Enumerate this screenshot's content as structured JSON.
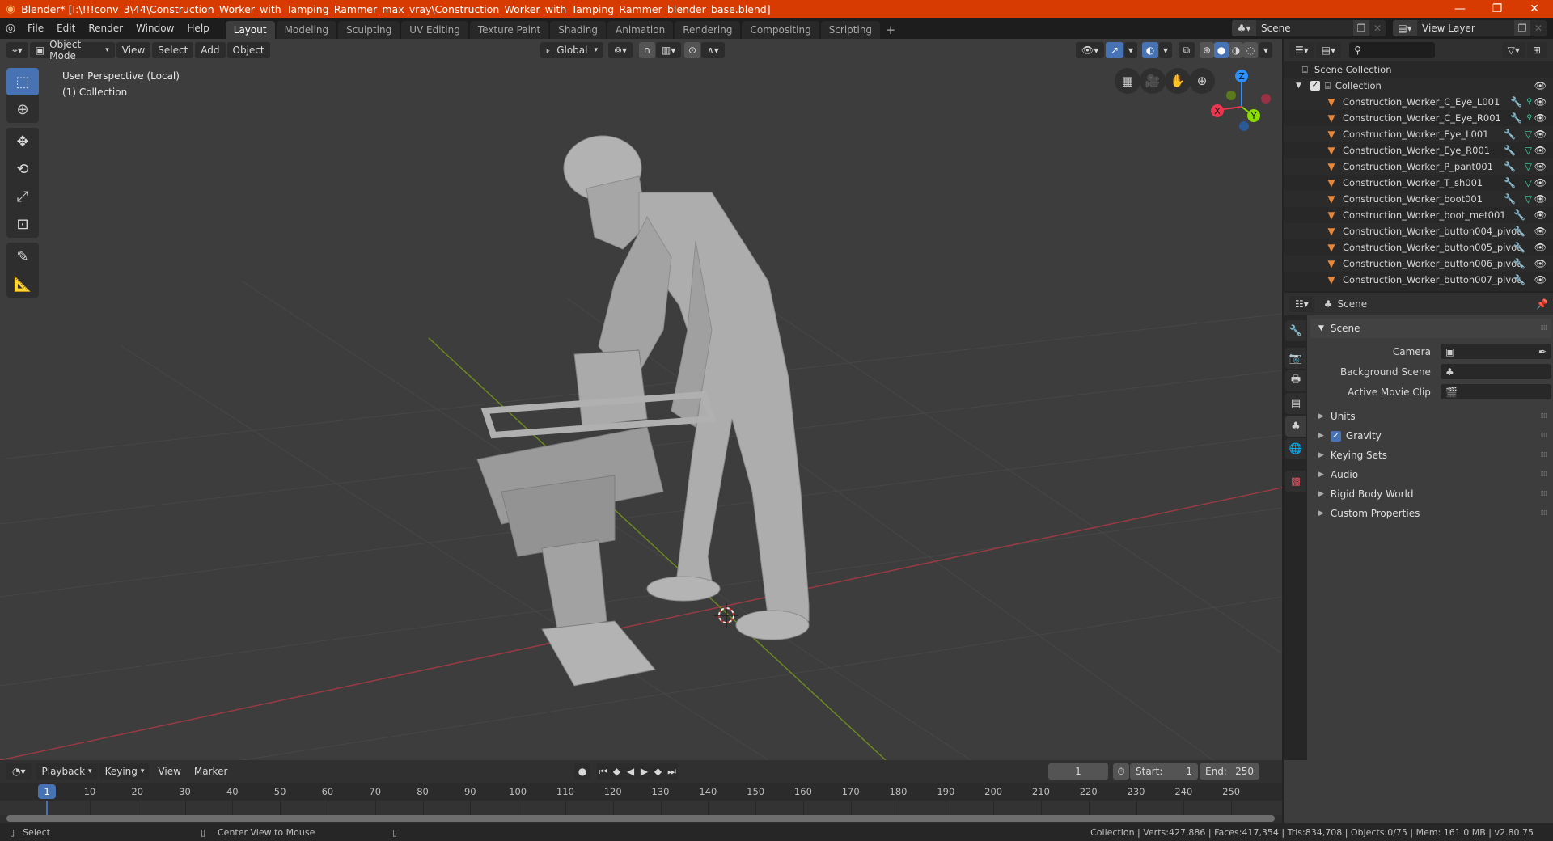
{
  "window": {
    "title": "Blender* [I:\\!!!conv_3\\44\\Construction_Worker_with_Tamping_Rammer_max_vray\\Construction_Worker_with_Tamping_Rammer_blender_base.blend]",
    "controls": {
      "minimize": "—",
      "maximize": "❐",
      "close": "✕"
    }
  },
  "menu": [
    "File",
    "Edit",
    "Render",
    "Window",
    "Help"
  ],
  "workspaces": {
    "tabs": [
      "Layout",
      "Modeling",
      "Sculpting",
      "UV Editing",
      "Texture Paint",
      "Shading",
      "Animation",
      "Rendering",
      "Compositing",
      "Scripting"
    ],
    "active": "Layout",
    "add": "+"
  },
  "scene_selector": {
    "value": "Scene"
  },
  "view_layer_selector": {
    "value": "View Layer"
  },
  "viewport_header": {
    "mode": "Object Mode",
    "menus": [
      "View",
      "Select",
      "Add",
      "Object"
    ],
    "orientation": "Global"
  },
  "viewport": {
    "perspective": "User Perspective (Local)",
    "collection": "(1) Collection",
    "gizmo": {
      "x": "X",
      "y": "Y",
      "z": "Z"
    },
    "colors": {
      "x_axis": "#e8374e",
      "y_axis": "#8bdc00",
      "z_axis": "#2c8fff",
      "grid_x": "#a03a45",
      "grid_y": "#6f8f1e"
    }
  },
  "outliner": {
    "root": "Scene Collection",
    "collection": "Collection",
    "items": [
      {
        "name": "Construction_Worker_C_Eye_L001",
        "mod": true,
        "data": "vertex"
      },
      {
        "name": "Construction_Worker_C_Eye_R001",
        "mod": true,
        "data": "vertex"
      },
      {
        "name": "Construction_Worker_Eye_L001",
        "mod": true,
        "data": "mesh"
      },
      {
        "name": "Construction_Worker_Eye_R001",
        "mod": true,
        "data": "mesh"
      },
      {
        "name": "Construction_Worker_P_pant001",
        "mod": true,
        "data": "mesh"
      },
      {
        "name": "Construction_Worker_T_sh001",
        "mod": true,
        "data": "mesh"
      },
      {
        "name": "Construction_Worker_boot001",
        "mod": true,
        "data": "mesh"
      },
      {
        "name": "Construction_Worker_boot_met001",
        "mod": true,
        "data": ""
      },
      {
        "name": "Construction_Worker_button004_pivot",
        "mod": true,
        "data": ""
      },
      {
        "name": "Construction_Worker_button005_pivot",
        "mod": true,
        "data": ""
      },
      {
        "name": "Construction_Worker_button006_pivot",
        "mod": true,
        "data": ""
      },
      {
        "name": "Construction_Worker_button007_pivot",
        "mod": true,
        "data": ""
      }
    ]
  },
  "properties": {
    "context": "Scene",
    "panel_title": "Scene",
    "fields": [
      {
        "label": "Camera",
        "value": ""
      },
      {
        "label": "Background Scene",
        "value": ""
      },
      {
        "label": "Active Movie Clip",
        "value": ""
      }
    ],
    "subpanels": [
      {
        "label": "Units",
        "checkbox": false
      },
      {
        "label": "Gravity",
        "checkbox": true,
        "checked": true
      },
      {
        "label": "Keying Sets",
        "checkbox": false
      },
      {
        "label": "Audio",
        "checkbox": false
      },
      {
        "label": "Rigid Body World",
        "checkbox": false
      },
      {
        "label": "Custom Properties",
        "checkbox": false
      }
    ]
  },
  "timeline": {
    "menus": [
      "Playback",
      "Keying",
      "View",
      "Marker"
    ],
    "current_frame": "1",
    "start_label": "Start:",
    "start": "1",
    "end_label": "End:",
    "end": "250",
    "ticks": [
      "10",
      "20",
      "30",
      "40",
      "50",
      "60",
      "70",
      "80",
      "90",
      "100",
      "110",
      "120",
      "130",
      "140",
      "150",
      "160",
      "170",
      "180",
      "190",
      "200",
      "210",
      "220",
      "230",
      "240",
      "250"
    ],
    "playhead": "1"
  },
  "statusbar": {
    "left_action": "Select",
    "middle_action": "Center View to Mouse",
    "stats": "Collection | Verts:427,886 | Faces:417,354 | Tris:834,708 | Objects:0/75 | Mem: 161.0 MB | v2.80.75"
  }
}
